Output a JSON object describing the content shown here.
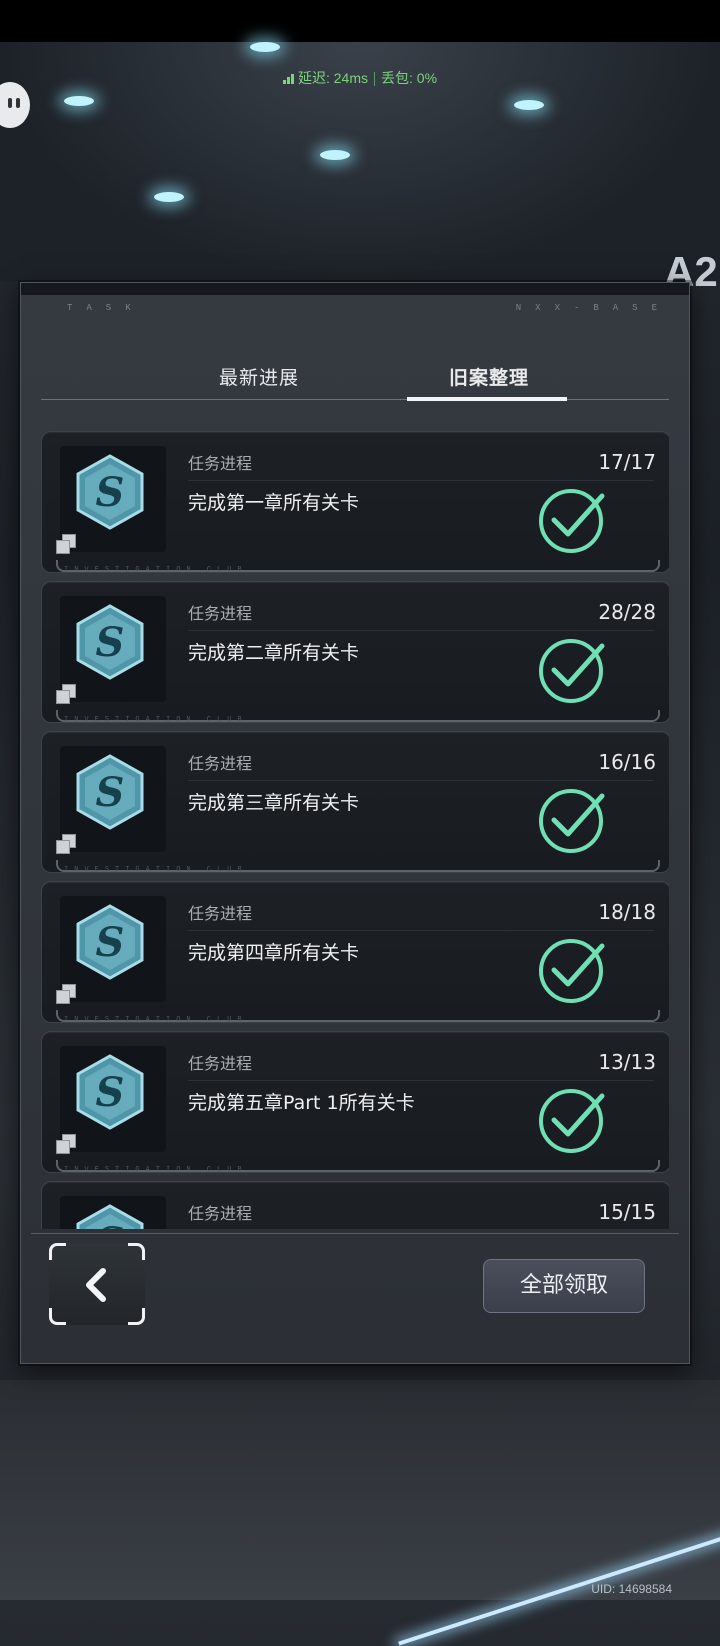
{
  "net": {
    "latency": "延迟: 24ms",
    "loss": "丢包: 0%",
    "signal_icon": "signal-bars"
  },
  "background": {
    "sign_text": "A2"
  },
  "panel": {
    "tag_left": "TASK",
    "tag_right": "NXX-BASE",
    "tabs": [
      {
        "label": "最新进展",
        "active": false
      },
      {
        "label": "旧案整理",
        "active": true
      }
    ]
  },
  "tasks": [
    {
      "label": "任务进程",
      "title": "完成第一章所有关卡",
      "progress": "17/17",
      "completed": true
    },
    {
      "label": "任务进程",
      "title": "完成第二章所有关卡",
      "progress": "28/28",
      "completed": true
    },
    {
      "label": "任务进程",
      "title": "完成第三章所有关卡",
      "progress": "16/16",
      "completed": true
    },
    {
      "label": "任务进程",
      "title": "完成第四章所有关卡",
      "progress": "18/18",
      "completed": true
    },
    {
      "label": "任务进程",
      "title": "完成第五章Part 1所有关卡",
      "progress": "13/13",
      "completed": true
    },
    {
      "label": "任务进程",
      "title": "",
      "progress": "15/15",
      "completed": true
    }
  ],
  "card_strip_text": "INVESTIGATION CLUB",
  "footer": {
    "claim_all_label": "全部领取",
    "back_icon": "chevron-left-icon"
  },
  "uid": "UID: 14698584",
  "colors": {
    "check": "#6fe0b4",
    "badge": "#5fa7b8"
  }
}
